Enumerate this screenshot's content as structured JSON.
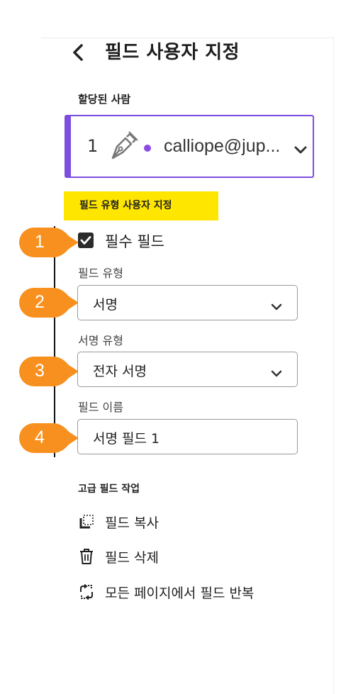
{
  "panel": {
    "title": "필드 사용자 지정"
  },
  "assignee": {
    "label": "할당된 사람",
    "number": "1",
    "email": "calliope@jup...",
    "color": "#7c4dde"
  },
  "customize": {
    "heading": "필드 유형 사용자 지정",
    "required_checkbox": {
      "label": "필수 필드",
      "checked": true
    },
    "field_type": {
      "label": "필드 유형",
      "value": "서명"
    },
    "signature_type": {
      "label": "서명 유형",
      "value": "전자 서명"
    },
    "field_name": {
      "label": "필드 이름",
      "value": "서명 필드 1"
    }
  },
  "callouts": [
    "1",
    "2",
    "3",
    "4"
  ],
  "advanced": {
    "heading": "고급 필드 작업",
    "actions": [
      {
        "label": "필드 복사",
        "icon": "copy-icon"
      },
      {
        "label": "필드 삭제",
        "icon": "trash-icon"
      },
      {
        "label": "모든 페이지에서 필드 반복",
        "icon": "repeat-icon"
      }
    ]
  },
  "colors": {
    "highlight": "#ffe600",
    "callout": "#f7901e",
    "accent": "#7c4dde"
  }
}
